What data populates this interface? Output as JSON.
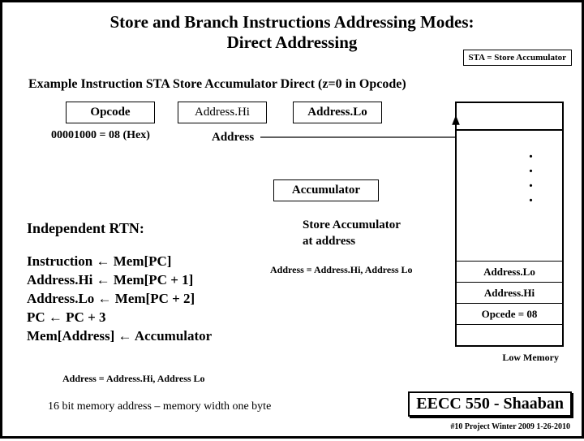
{
  "title_line1": "Store  and Branch Instructions Addressing Modes:",
  "title_line2": "Direct Addressing",
  "sta_box": "STA = Store Accumulator",
  "example": "Example Instruction  STA Store Accumulator Direct (z=0 in Opcode)",
  "opcode": "Opcode",
  "addrhi": "Address.Hi",
  "addrlo": "Address.Lo",
  "hexline": "00001000 = 08 (Hex)",
  "address_lbl": "Address",
  "accumulator": "Accumulator",
  "store_txt": "Store Accumulator",
  "at_addr": "at address",
  "rtn_title": "Independent RTN:",
  "rtn1": "Instruction  ←     Mem[PC]",
  "rtn2": "Address.Hi ←  Mem[PC + 1]",
  "rtn3": "Address.Lo ←  Mem[PC + 2]",
  "rtn4": "PC  ←     PC + 3",
  "rtn5": "Mem[Address]  ← Accumulator",
  "addr_eq": "Address = Address.Hi, Address Lo",
  "memwidth": "16 bit memory address – memory width one byte",
  "mem_addrlo": "Address.Lo",
  "mem_addrhi": "Address.Hi",
  "mem_opcede": "Opcede = 08",
  "lowmem": "Low Memory",
  "footer_box": "EECC 550 - Shaaban",
  "footer_line": "#10   Project  Winter 2009   1-26-2010"
}
